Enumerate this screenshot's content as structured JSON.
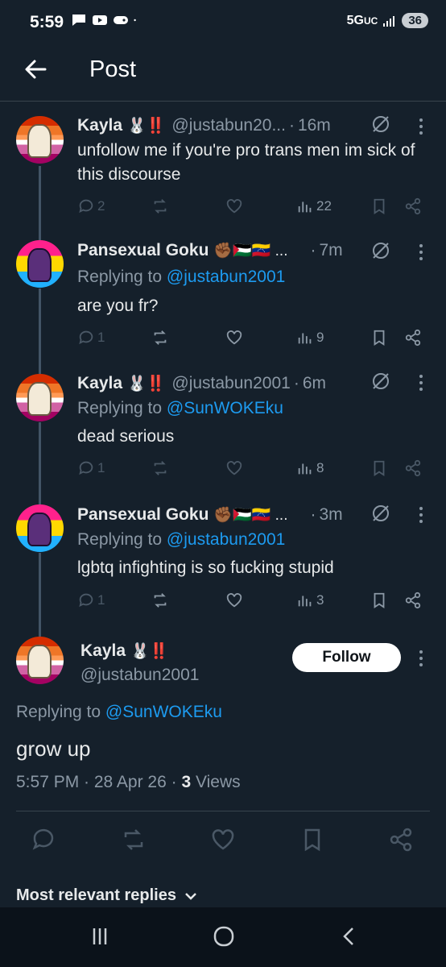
{
  "status": {
    "time": "5:59",
    "network": "5G",
    "network_sub": "UC",
    "battery": "36"
  },
  "header": {
    "title": "Post"
  },
  "tweets": [
    {
      "name": "Kayla",
      "emoji": "🐰‼️",
      "handle": "@justabun20...",
      "dot": "·",
      "age": "16m",
      "replying_prefix": "",
      "replying_to": "",
      "text": "unfollow me if you're pro trans men im sick of this discourse",
      "replies": "2",
      "retweets": "",
      "likes": "",
      "views": "22"
    },
    {
      "name": "Pansexual Goku",
      "emoji": "✊🏾🇵🇸🇻🇪 ...",
      "handle": "",
      "dot": "·",
      "age": "7m",
      "replying_prefix": "Replying to",
      "replying_to": "@justabun2001",
      "text": "are you fr?",
      "replies": "1",
      "retweets": "",
      "likes": "",
      "views": "9"
    },
    {
      "name": "Kayla",
      "emoji": "🐰‼️",
      "handle": "@justabun2001",
      "dot": "·",
      "age": "6m",
      "replying_prefix": "Replying to",
      "replying_to": "@SunWOKEku",
      "text": "dead serious",
      "replies": "1",
      "retweets": "",
      "likes": "",
      "views": "8"
    },
    {
      "name": "Pansexual Goku",
      "emoji": "✊🏾🇵🇸🇻🇪 ...",
      "handle": "",
      "dot": "·",
      "age": "3m",
      "replying_prefix": "Replying to",
      "replying_to": "@justabun2001",
      "text": "lgbtq infighting is so fucking stupid",
      "replies": "1",
      "retweets": "",
      "likes": "",
      "views": "3"
    }
  ],
  "main_post": {
    "name": "Kayla",
    "emoji": "🐰‼️",
    "handle": "@justabun2001",
    "follow_label": "Follow",
    "replying_prefix": "Replying to",
    "replying_to": "@SunWOKEku",
    "text": "grow up",
    "timestamp": "5:57 PM · 28 Apr 26 ·",
    "views_count": "3",
    "views_label": "Views"
  },
  "replies_section": {
    "label": "Most relevant replies"
  },
  "colors": {
    "background": "#15202b",
    "accent": "#1d9bf0",
    "muted": "#8b98a5",
    "dim_icon": "#4a5866",
    "divider": "#38444d"
  }
}
